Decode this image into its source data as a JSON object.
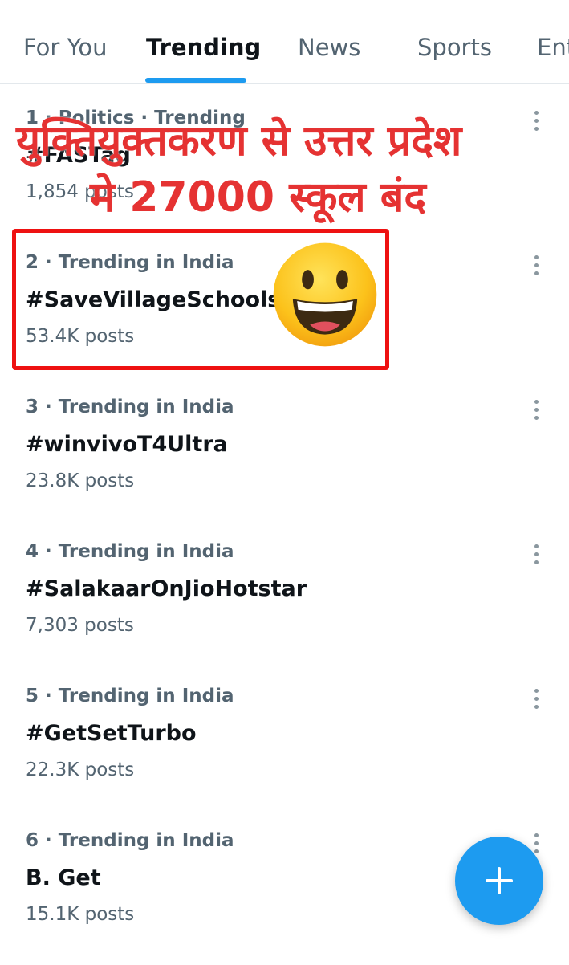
{
  "tabs": [
    {
      "label": "For You",
      "active": false
    },
    {
      "label": "Trending",
      "active": true
    },
    {
      "label": "News",
      "active": false
    },
    {
      "label": "Sports",
      "active": false
    },
    {
      "label": "Ent",
      "active": false
    }
  ],
  "trends": [
    {
      "meta": "1 · Politics · Trending",
      "topic": "#FASTag",
      "posts": "1,854 posts"
    },
    {
      "meta": "2 · Trending in India",
      "topic": "#SaveVillageSchools",
      "posts": "53.4K posts"
    },
    {
      "meta": "3 · Trending in India",
      "topic": "#winvivoT4Ultra",
      "posts": "23.8K posts"
    },
    {
      "meta": "4 · Trending in India",
      "topic": "#SalakaarOnJioHotstar",
      "posts": "7,303 posts"
    },
    {
      "meta": "5 · Trending in India",
      "topic": "#GetSetTurbo",
      "posts": "22.3K posts"
    },
    {
      "meta": "6 · Trending in India",
      "topic": "B. Get",
      "posts": "15.1K posts"
    }
  ],
  "overlay": {
    "line1": "युक्तियुक्तकरण से उत्तर प्रदेश",
    "line2": "मे 27000 स्कूल बंद",
    "color": "#e53232",
    "highlight_color": "#ee1111"
  },
  "icons": {
    "more": "more-vertical-icon",
    "emoji": "smiling-face-icon",
    "compose": "plus-icon"
  },
  "colors": {
    "accent": "#1d9bf0",
    "text_primary": "#0f1419",
    "text_secondary": "#536471"
  }
}
